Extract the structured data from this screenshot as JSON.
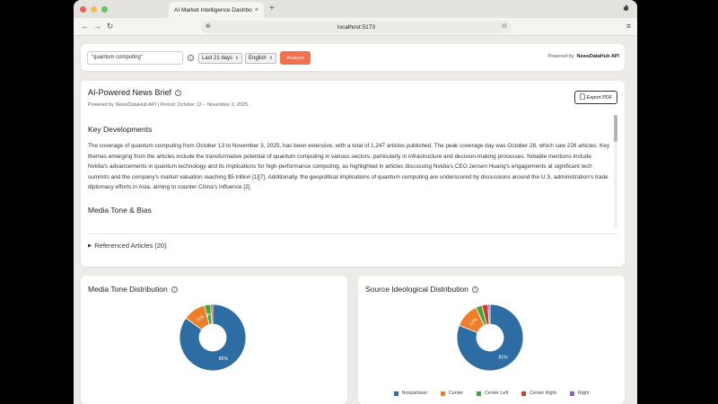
{
  "browser": {
    "tab_title": "AI Market Intelligence Dashboard",
    "tab_close": "×",
    "new_tab": "+",
    "url": "localhost:5173"
  },
  "search": {
    "query": "\"quantum computing\"",
    "period": "Last 21 days",
    "language": "English",
    "analyze_label": "Analyze",
    "powered_prefix": "Powered by",
    "powered_brand": "NewsDataHub API"
  },
  "brief": {
    "title": "AI-Powered News Brief",
    "subtitle": "Powered by NewsDataHub API | Period: October 12 – November 2, 2025",
    "export_label": "Export PDF",
    "section1_title": "Key Developments",
    "section1_body": "The coverage of quantum computing from October 13 to November 3, 2025, has been extensive, with a total of 1,247 articles published. The peak coverage day was October 28, which saw 226 articles. Key themes emerging from the articles include the transformative potential of quantum computing in various sectors, particularly in infrastructure and decision-making processes. Notable mentions include Nvidia's advancements in quantum technology and its implications for high-performance computing, as highlighted in articles discussing Nvidia's CEO Jensen Huang's engagements at significant tech summits and the company's market valuation reaching $5 trillion [1][7]. Additionally, the geopolitical implications of quantum computing are underscored by discussions around the U.S. administration's trade diplomacy efforts in Asia, aiming to counter China's influence [2].",
    "section2_title": "Media Tone & Bias",
    "references_label": "Referenced Articles (20)"
  },
  "tone_chart": {
    "title": "Media Tone Distribution"
  },
  "source_chart": {
    "title": "Source Ideological Distribution"
  },
  "colors": {
    "blue": "#2e6da4",
    "orange": "#f07d27",
    "green": "#3fa53f",
    "red": "#d23c2c",
    "purple": "#8a5fb5",
    "accent": "#f0704f"
  },
  "chart_data": [
    {
      "type": "pie",
      "title": "Media Tone Distribution",
      "slices": [
        {
          "value": 85,
          "label": "85%",
          "color": "#2e6da4"
        },
        {
          "value": 11,
          "label": "11%",
          "color": "#f07d27"
        },
        {
          "value": 3,
          "label": "3%",
          "color": "#3fa53f"
        },
        {
          "value": 1,
          "label": "",
          "color": "#d23c2c"
        }
      ]
    },
    {
      "type": "pie",
      "title": "Source Ideological Distribution",
      "legend": [
        "Nonpartisan",
        "Center",
        "Center Left",
        "Center Right",
        "Right"
      ],
      "slices": [
        {
          "value": 81,
          "label": "81%",
          "name": "Nonpartisan",
          "color": "#2e6da4"
        },
        {
          "value": 12,
          "label": "12%",
          "name": "Center",
          "color": "#f07d27"
        },
        {
          "value": 3,
          "label": "",
          "name": "Center Left",
          "color": "#3fa53f"
        },
        {
          "value": 3,
          "label": "",
          "name": "Center Right",
          "color": "#d23c2c"
        },
        {
          "value": 1,
          "label": "",
          "name": "Right",
          "color": "#8a5fb5"
        }
      ]
    }
  ]
}
